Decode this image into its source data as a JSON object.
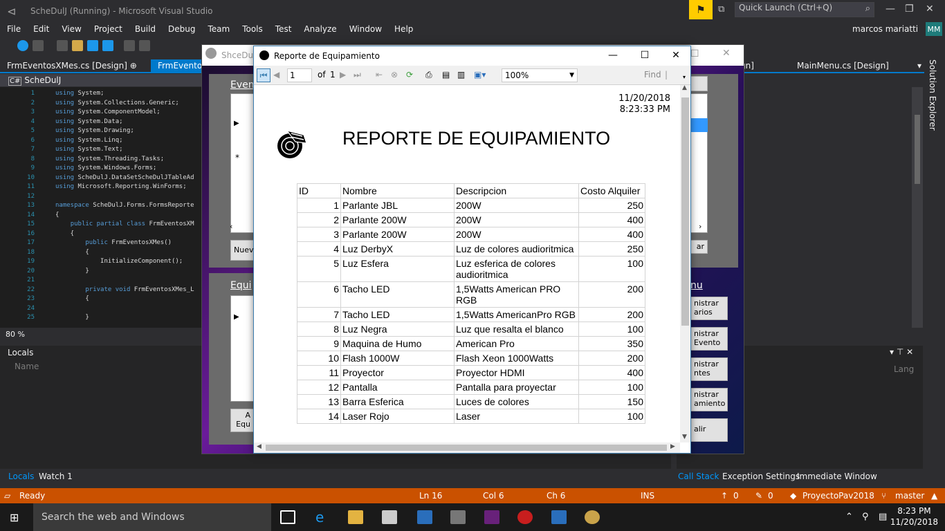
{
  "window": {
    "title": "ScheDulJ (Running) - Microsoft Visual Studio",
    "quick_launch": "Quick Launch (Ctrl+Q)"
  },
  "menu": [
    "File",
    "Edit",
    "View",
    "Project",
    "Build",
    "Debug",
    "Team",
    "Tools",
    "Test",
    "Analyze",
    "Window",
    "Help"
  ],
  "user": {
    "name": "marcos mariatti",
    "initials": "MM"
  },
  "tabs": [
    "FrmEventosXMes.cs [Design]",
    "FrmEventosX",
    "gn]",
    "MainMenu.cs [Design]"
  ],
  "doc_bar": "ScheDulJ",
  "editor": {
    "line_numbers": [
      "1",
      "2",
      "3",
      "4",
      "5",
      "6",
      "7",
      "8",
      "9",
      "10",
      "11",
      "12",
      "13",
      "14",
      "15",
      "16",
      "17",
      "18",
      "19",
      "20",
      "21",
      "22",
      "23",
      "24",
      "25"
    ],
    "lines": [
      "using System;",
      "using System.Collections.Generic;",
      "using System.ComponentModel;",
      "using System.Data;",
      "using System.Drawing;",
      "using System.Linq;",
      "using System.Text;",
      "using System.Threading.Tasks;",
      "using System.Windows.Forms;",
      "using ScheDulJ.DataSetScheDulJTableAd",
      "using Microsoft.Reporting.WinForms;",
      "",
      "namespace ScheDulJ.Forms.FormsReporte",
      "{",
      "    public partial class FrmEventosXM",
      "    {",
      "        public FrmEventosXMes()",
      "        {",
      "            InitializeComponent();",
      "        }",
      "",
      "        private void FrmEventosXMes_L",
      "        {",
      "",
      "        }"
    ],
    "zoom": "80 %"
  },
  "locals": {
    "title": "Locals",
    "col_name": "Name",
    "col_lang": "Lang"
  },
  "bottom_tabs_left": [
    "Locals",
    "Watch 1"
  ],
  "bottom_tabs_right": [
    "Call Stack",
    "Exception Settings",
    "Immediate Window"
  ],
  "solution_explorer": "Solution Explorer",
  "status": {
    "state": "Ready",
    "ln": "Ln 16",
    "col": "Col 6",
    "ch": "Ch 6",
    "ins": "INS",
    "up": "0",
    "edits": "0",
    "repo": "ProyectoPav2018",
    "branch": "master"
  },
  "taskbar": {
    "search": "Search the web and Windows",
    "time": "8:23 PM",
    "date": "11/20/2018"
  },
  "bg_form": {
    "title": "ShceDulJ",
    "label1": "Even",
    "label2": "Equi",
    "btn_nuevo": "Nuev",
    "btn_a": "A\nEqu",
    "btn_ar": "ar",
    "menu_label": "nu",
    "side_buttons": [
      "nistrar\narios",
      "nistrar\nEvento",
      "nistrar\nntes",
      "nistrar\namiento",
      "alir"
    ]
  },
  "report": {
    "title": "Reporte de Equipamiento",
    "page": "1",
    "of_label": "of",
    "total_pages": "1",
    "zoom": "100%",
    "find": "Find",
    "date": "11/20/2018",
    "time": "8:23:33 PM",
    "heading": "REPORTE DE EQUIPAMIENTO",
    "columns": [
      "ID",
      "Nombre",
      "Descripcion",
      "Costo Alquiler"
    ],
    "rows": [
      [
        "1",
        "Parlante JBL",
        "200W",
        "250"
      ],
      [
        "2",
        "Parlante 200W",
        "200W",
        "400"
      ],
      [
        "3",
        "Parlante 200W",
        "200W",
        "400"
      ],
      [
        "4",
        "Luz DerbyX",
        "Luz de colores audioritmica",
        "250"
      ],
      [
        "5",
        "Luz Esfera",
        "Luz esferica de colores audioritmica",
        "100"
      ],
      [
        "6",
        "Tacho LED",
        "1,5Watts American PRO RGB",
        "200"
      ],
      [
        "7",
        "Tacho LED",
        "1,5Watts AmericanPro RGB",
        "200"
      ],
      [
        "8",
        "Luz Negra",
        "Luz que resalta el blanco",
        "100"
      ],
      [
        "9",
        "Maquina de Humo",
        "American Pro",
        "350"
      ],
      [
        "10",
        "Flash 1000W",
        "Flash Xeon 1000Watts",
        "200"
      ],
      [
        "11",
        "Proyector",
        "Proyector HDMI",
        "400"
      ],
      [
        "12",
        "Pantalla",
        "Pantalla para proyectar",
        "100"
      ],
      [
        "13",
        "Barra Esferica",
        "Luces de colores",
        "150"
      ],
      [
        "14",
        "Laser Rojo",
        "Laser",
        "100"
      ]
    ]
  }
}
